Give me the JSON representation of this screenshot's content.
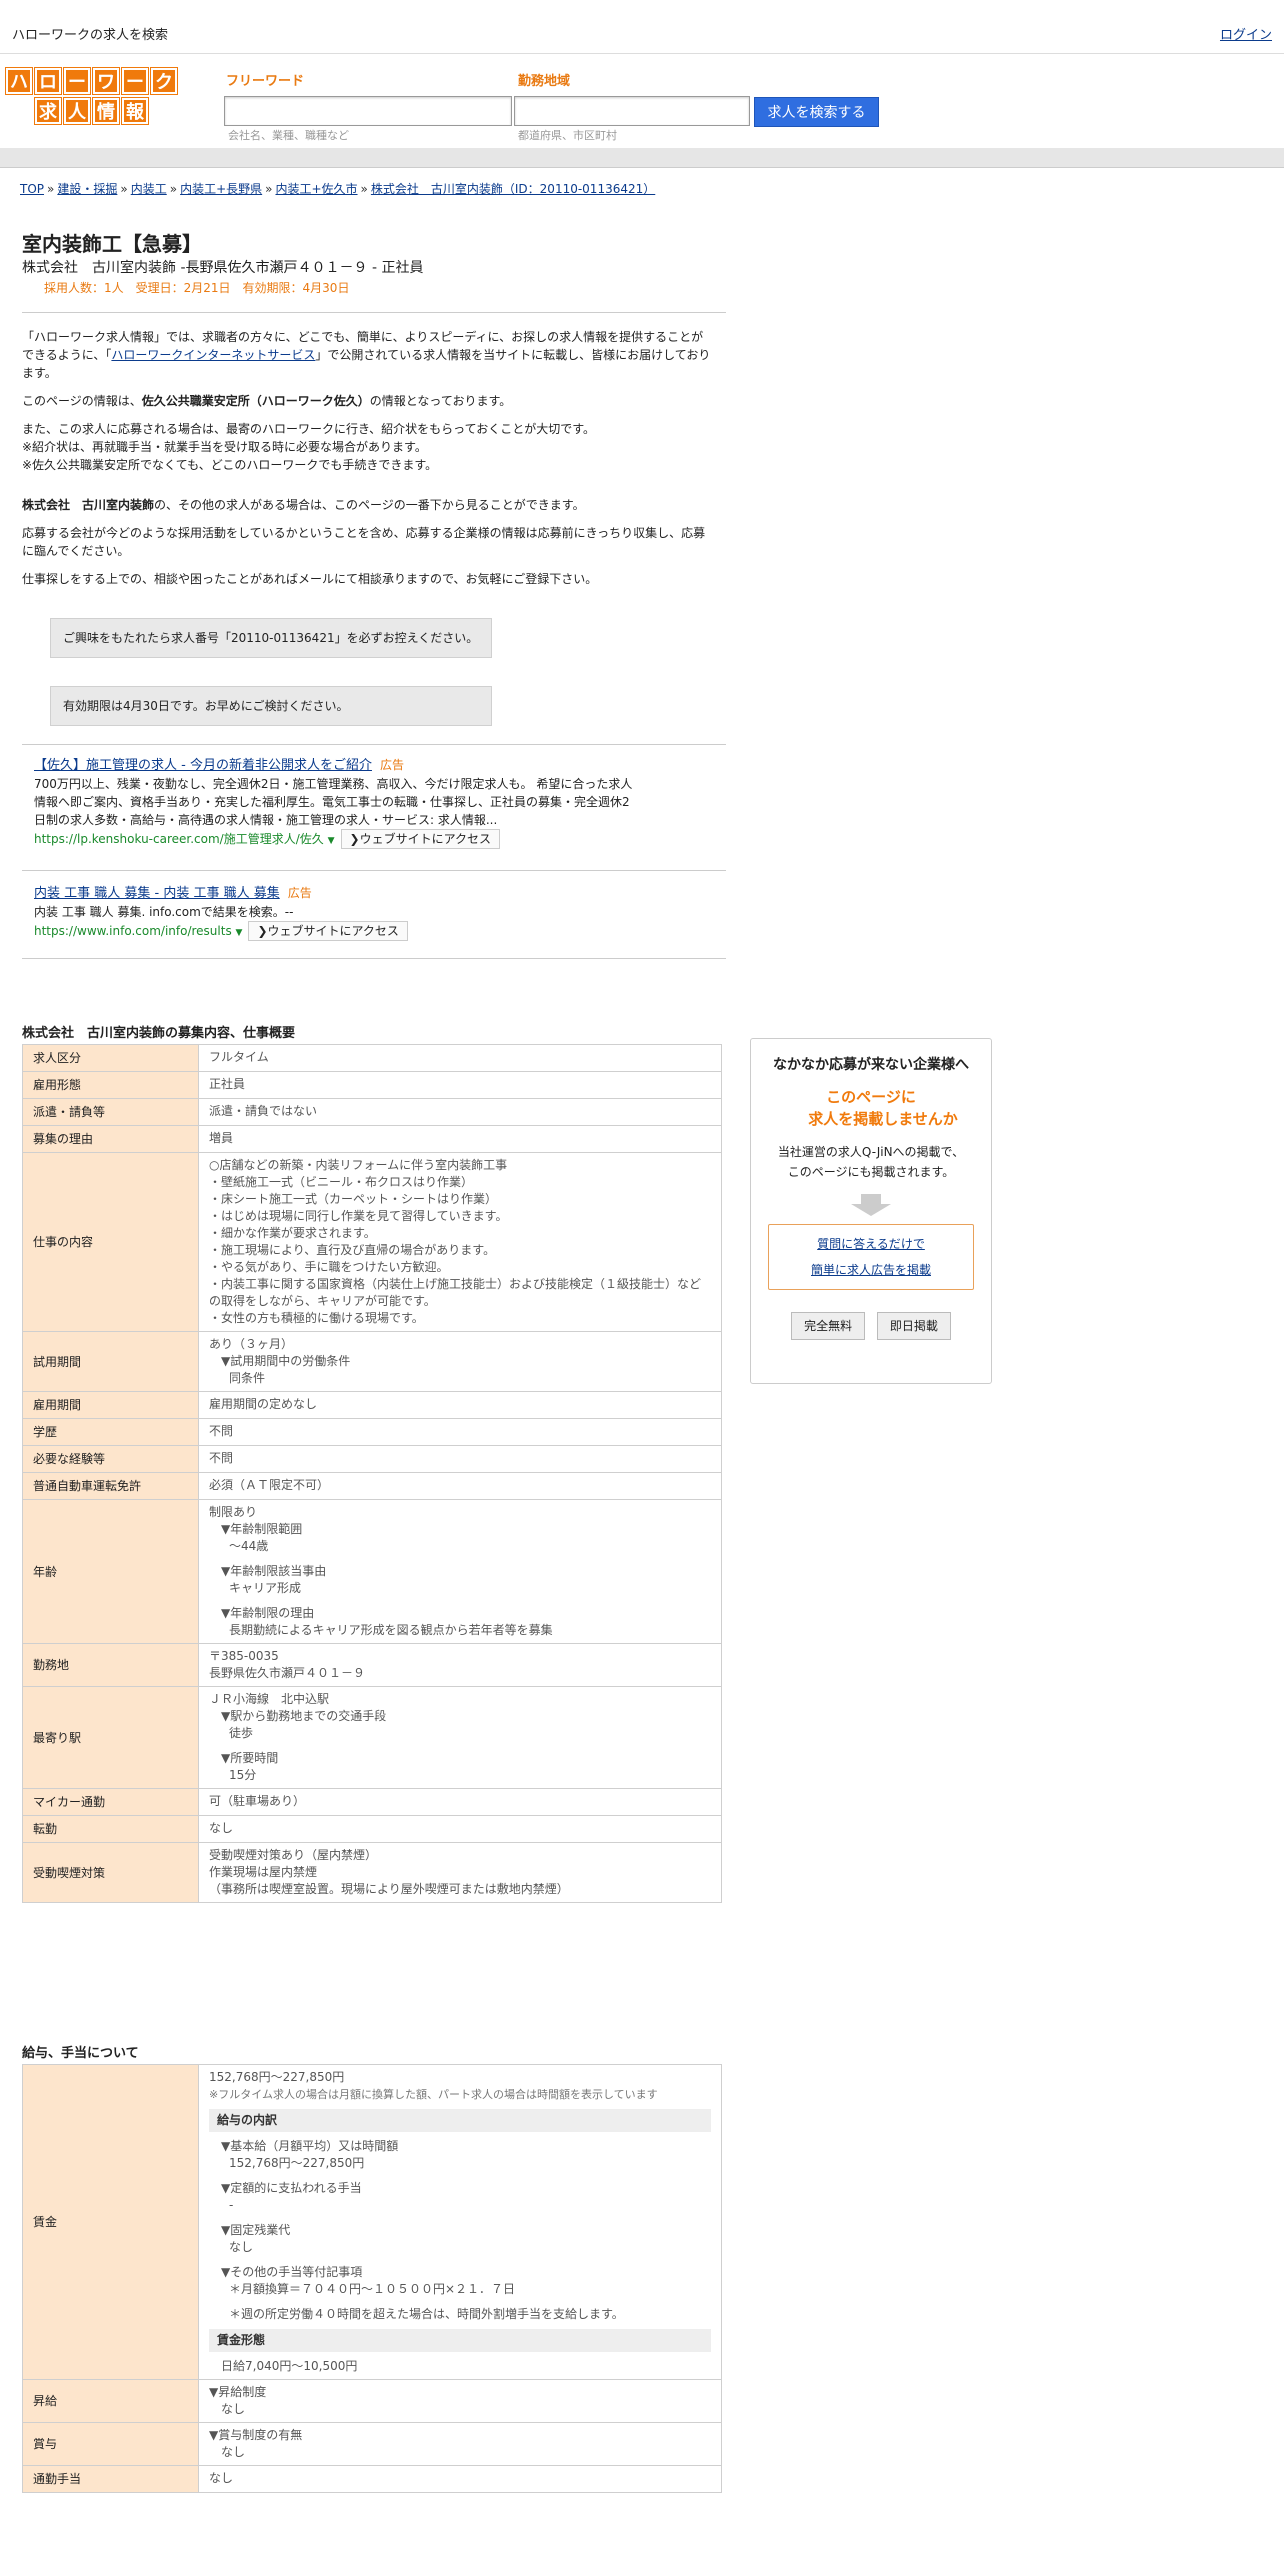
{
  "topbar": {
    "site_title": "ハローワークの求人を検索",
    "login": "ログイン"
  },
  "logo": {
    "row1": [
      "ハ",
      "ロ",
      "ー",
      "ワ",
      "ー",
      "ク"
    ],
    "row2": [
      "求",
      "人",
      "情",
      "報"
    ]
  },
  "search": {
    "keyword_label": "フリーワード",
    "keyword_hint": "会社名、業種、職種など",
    "area_label": "勤務地域",
    "area_hint": "都道府県、市区町村",
    "button": "求人を検索する"
  },
  "breadcrumb": [
    "TOP",
    "建設・採掘",
    "内装工",
    "内装工+長野県",
    "内装工+佐久市",
    "株式会社　古川室内装飾（ID：20110-01136421）"
  ],
  "breadcrumb_sep": "»",
  "job": {
    "title": "室内装飾工【急募】",
    "company_line": "株式会社　古川室内装飾 -長野県佐久市瀬戸４０１－９ - 正社員",
    "meta": "採用人数：1人　受理日：2月21日　有効期限：4月30日"
  },
  "intro": {
    "p1a": "「ハローワーク求人情報」では、求職者の方々に、どこでも、簡単に、よりスピーディに、お探しの求人情報を提供することができるように、「",
    "p1link": "ハローワークインターネットサービス",
    "p1b": "」で公開されている求人情報を当サイトに転載し、皆様にお届けしております。",
    "p2a": "このページの情報は、",
    "p2b": "佐久公共職業安定所（ハローワーク佐久）",
    "p2c": "の情報となっております。",
    "p3": "また、この求人に応募される場合は、最寄のハローワークに行き、紹介状をもらっておくことが大切です。",
    "p4": "※紹介状は、再就職手当・就業手当を受け取る時に必要な場合があります。",
    "p5": "※佐久公共職業安定所でなくても、どこのハローワークでも手続きできます。",
    "p6a": "株式会社　古川室内装飾",
    "p6b": "の、その他の求人がある場合は、このページの一番下から見ることができます。",
    "p7": "応募する会社が今どのような採用活動をしているかということを含め、応募する企業様の情報は応募前にきっちり収集し、応募に臨んでください。",
    "p8": "仕事探しをする上での、相談や困ったことがあればメールにて相談承りますので、お気軽にご登録下さい。"
  },
  "notices": {
    "n1": "ご興味をもたれたら求人番号「20110-01136421」を必ずお控えください。",
    "n2": "有効期限は4月30日です。お早めにご検討ください。"
  },
  "ads": [
    {
      "title": "【佐久】施工管理の求人 - 今月の新着非公開求人をご紹介",
      "tag": "広告",
      "desc": "700万円以上、残業・夜勤なし、完全週休2日・施工管理業務、高収入、今だけ限定求人も。 希望に合った求人情報へ即ご案内、資格手当あり・充実した福利厚生。電気工事士の転職・仕事探し、正社員の募集・完全週休2日制の求人多数・高給与・高待遇の求人情報・施工管理の求人・サービス: 求人情報...",
      "url": "https://lp.kenshoku-career.com/施工管理求人/佐久",
      "visit": "❯ウェブサイトにアクセス"
    },
    {
      "title": "内装 工事 職人 募集 - 内装 工事 職人 募集",
      "tag": "広告",
      "desc": "内装 工事 職人 募集. info.comで結果を検索。--",
      "url": "https://www.info.com/info/results",
      "visit": "❯ウェブサイトにアクセス"
    }
  ],
  "section1_title": "株式会社　古川室内装飾の募集内容、仕事概要",
  "table1": {
    "kubun": [
      "求人区分",
      "フルタイム"
    ],
    "koyo": [
      "雇用形態",
      "正社員"
    ],
    "haken": [
      "派遣・請負等",
      "派遣・請負ではない"
    ],
    "riyu": [
      "募集の理由",
      "増員"
    ],
    "naiyo_h": "仕事の内容",
    "naiyo": [
      "○店舗などの新築・内装リフォームに伴う室内装飾工事",
      "・壁紙施工一式（ビニール・布クロスはり作業）",
      "・床シート施工一式（カーペット・シートはり作業）",
      "・はじめは現場に同行し作業を見て習得していきます。",
      "・細かな作業が要求されます。",
      "・施工現場により、直行及び直帰の場合があります。",
      "・やる気があり、手に職をつけたい方歓迎。",
      "・内装工事に関する国家資格（内装仕上げ施工技能士）および技能検定（１級技能士）などの取得をしながら、キャリアが可能です。",
      "・女性の方も積極的に働ける現場です。"
    ],
    "shiyo_h": "試用期間",
    "shiyo": [
      "あり（３ヶ月）",
      "▼試用期間中の労働条件",
      "同条件"
    ],
    "kikan": [
      "雇用期間",
      "雇用期間の定めなし"
    ],
    "gakureki": [
      "学歴",
      "不問"
    ],
    "keiken": [
      "必要な経験等",
      "不問"
    ],
    "menkyo": [
      "普通自動車運転免許",
      "必須（ＡＴ限定不可）"
    ],
    "nenrei_h": "年齢",
    "nenrei": [
      "制限あり",
      "▼年齢制限範囲",
      "〜44歳",
      "▼年齢制限該当事由",
      "キャリア形成",
      "▼年齢制限の理由",
      "長期勤続によるキャリア形成を図る観点から若年者等を募集"
    ],
    "kinmuchi_h": "勤務地",
    "kinmuchi": [
      "〒385-0035",
      "長野県佐久市瀬戸４０１－９"
    ],
    "eki_h": "最寄り駅",
    "eki": [
      "ＪＲ小海線　北中込駅",
      "▼駅から勤務地までの交通手段",
      "徒歩",
      "▼所要時間",
      "15分"
    ],
    "mycar": [
      "マイカー通勤",
      "可（駐車場あり）"
    ],
    "tenkin": [
      "転勤",
      "なし"
    ],
    "kitsuen_h": "受動喫煙対策",
    "kitsuen": [
      "受動喫煙対策あり（屋内禁煙）",
      "作業現場は屋内禁煙",
      "（事務所は喫煙室設置。現場により屋外喫煙可または敷地内禁煙）"
    ]
  },
  "section2_title": "給与、手当について",
  "table2": {
    "chingin_h": "賃金",
    "range": "152,768円〜227,850円",
    "note": "※フルタイム求人の場合は月額に換算した額、パート求人の場合は時間額を表示しています",
    "uchiwake": "給与の内訳",
    "kihon_h": "▼基本給（月額平均）又は時間額",
    "kihon": "152,768円〜227,850円",
    "teigaku_h": "▼定額的に支払われる手当",
    "teigaku": "-",
    "kotei_h": "▼固定残業代",
    "kotei": "なし",
    "sonota_h": "▼その他の手当等付記事項",
    "sonota1": "＊月額換算＝７０４０円～１０５００円×２１．７日",
    "sonota2": "＊週の所定労働４０時間を超えた場合は、時間外割増手当を支給します。",
    "keitai_h": "賃金形態",
    "keitai": "日給7,040円〜10,500円",
    "shokyu_h": "昇給",
    "shokyu": [
      "▼昇給制度",
      "なし"
    ],
    "shoyo_h": "賞与",
    "shoyo": [
      "▼賞与制度の有無",
      "なし"
    ],
    "tsukin_h": "通勤手当",
    "tsukin": "なし"
  },
  "side": {
    "heading": "なかなか応募が来ない企業様へ",
    "offer1": "このページに",
    "offer2": "求人を掲載しませんか",
    "desc1": "当社運営の求人Q-JiNへの掲載で、",
    "desc2": "このページにも掲載されます。",
    "link1": "質問に答えるだけで",
    "link2": "簡単に求人広告を掲載",
    "btn1": "完全無料",
    "btn2": "即日掲載"
  }
}
